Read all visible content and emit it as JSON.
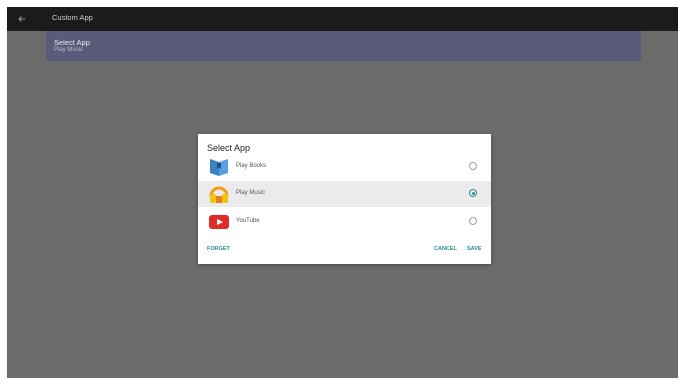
{
  "header": {
    "title": "Custom App"
  },
  "setting": {
    "title": "Select App",
    "value": "Play Music"
  },
  "dialog": {
    "title": "Select App",
    "options": [
      {
        "label": "Play Books",
        "icon": "play-books-icon",
        "selected": false
      },
      {
        "label": "Play Music",
        "icon": "play-music-icon",
        "selected": true
      },
      {
        "label": "YouTube",
        "icon": "youtube-icon",
        "selected": false
      }
    ],
    "buttons": {
      "forget": "FORGET",
      "cancel": "CANCEL",
      "save": "SAVE"
    }
  },
  "colors": {
    "accent": "#2a8f92",
    "youtube": "#e02b2b"
  }
}
